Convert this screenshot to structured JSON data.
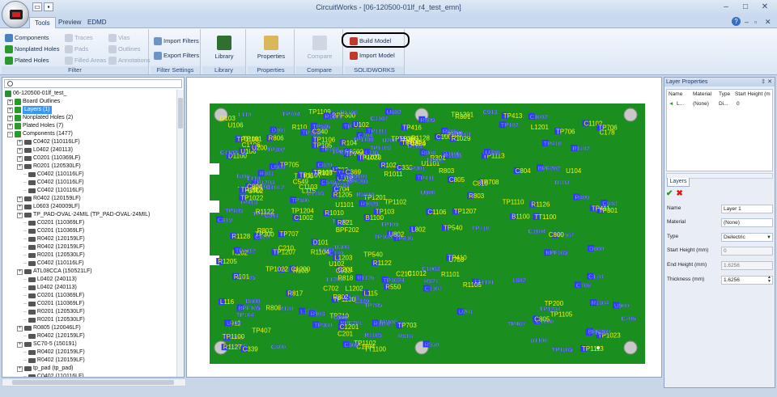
{
  "window": {
    "title": "CircuitWorks - [06-120500-01lf_r4_test_emn]"
  },
  "ribbon_tabs": [
    "Tools",
    "Preview",
    "EDMD"
  ],
  "ribbon": {
    "groups": {
      "filter": "Filter",
      "filter_settings": "Filter Settings",
      "library": "Library",
      "properties": "Properties",
      "compare": "Compare",
      "solidworks": "SOLIDWORKS"
    },
    "filter_items": {
      "components": "Components",
      "nonplated_holes": "Nonplated Holes",
      "plated_holes": "Plated Holes",
      "traces": "Traces",
      "pads": "Pads",
      "filled_areas": "Filled Areas",
      "vias": "Vias",
      "outlines": "Outlines",
      "annotations": "Annotations"
    },
    "import_filters": "Import Filters",
    "export_filters": "Export Filters",
    "library": "Library",
    "properties": "Properties",
    "compare": "Compare",
    "build_model": "Build Model",
    "import_model": "Import Model"
  },
  "tree": {
    "root": "06-120500-01lf_test_",
    "board_outlines": "Board Outlines",
    "layers": "Layers (1)",
    "nonplated_holes": "Nonplated Holes (2)",
    "plated_holes": "Plated Holes (7)",
    "components": "Components (1477)",
    "items": [
      {
        "label": "C0402 (110116LF)",
        "level": 1,
        "expandable": true
      },
      {
        "label": "L0402 (240113)",
        "level": 1,
        "expandable": true
      },
      {
        "label": "C0201 (110369LF)",
        "level": 1,
        "expandable": true
      },
      {
        "label": "R0201 (120530LF)",
        "level": 1,
        "expandable": true
      },
      {
        "label": "C0402 (110116LF)",
        "level": 2,
        "expandable": false
      },
      {
        "label": "C0402 (110116LF)",
        "level": 2,
        "expandable": false
      },
      {
        "label": "C0402 (110116LF)",
        "level": 2,
        "expandable": false
      },
      {
        "label": "R0402 (120159LF)",
        "level": 1,
        "expandable": true
      },
      {
        "label": "L0603 (240009LF)",
        "level": 1,
        "expandable": true
      },
      {
        "label": "TP_PAD-OVAL-24MIL (TP_PAD-OVAL-24MIL)",
        "level": 1,
        "expandable": true
      },
      {
        "label": "C0201 (110369LF)",
        "level": 2,
        "expandable": false
      },
      {
        "label": "C0201 (110369LF)",
        "level": 2,
        "expandable": false
      },
      {
        "label": "R0402 (120159LF)",
        "level": 2,
        "expandable": false
      },
      {
        "label": "R0402 (120159LF)",
        "level": 2,
        "expandable": false
      },
      {
        "label": "R0201 (120530LF)",
        "level": 2,
        "expandable": false
      },
      {
        "label": "C0402 (110116LF)",
        "level": 2,
        "expandable": false
      },
      {
        "label": "ATL08CCA (150521LF)",
        "level": 1,
        "expandable": true
      },
      {
        "label": "L0402 (240113)",
        "level": 2,
        "expandable": false
      },
      {
        "label": "L0402 (240113)",
        "level": 2,
        "expandable": false
      },
      {
        "label": "C0201 (110369LF)",
        "level": 2,
        "expandable": false
      },
      {
        "label": "C0201 (110369LF)",
        "level": 2,
        "expandable": false
      },
      {
        "label": "R0201 (120530LF)",
        "level": 2,
        "expandable": false
      },
      {
        "label": "R0201 (120530LF)",
        "level": 2,
        "expandable": false
      },
      {
        "label": "R0805 (120046LF)",
        "level": 1,
        "expandable": true
      },
      {
        "label": "R0402 (120159LF)",
        "level": 2,
        "expandable": false
      },
      {
        "label": "SC70-5 (150191)",
        "level": 1,
        "expandable": true
      },
      {
        "label": "R0402 (120159LF)",
        "level": 2,
        "expandable": false
      },
      {
        "label": "R0402 (120159LF)",
        "level": 2,
        "expandable": false
      },
      {
        "label": "tp_pad (tp_pad)",
        "level": 1,
        "expandable": true
      },
      {
        "label": "C0402 (110116LF)",
        "level": 2,
        "expandable": false
      }
    ]
  },
  "layer_properties": {
    "title": "Layer Properties",
    "columns": [
      "Name",
      "Material",
      "Type",
      "Start Height (m"
    ],
    "row": {
      "name": "L...",
      "material": "(None)",
      "type": "Di...",
      "start_height": "0"
    },
    "tab": "Layers",
    "fields": {
      "name_label": "Name",
      "name_value": "Layer 1",
      "material_label": "Material",
      "material_value": "(None)",
      "type_label": "Type",
      "type_value": "Dielectric",
      "start_height_label": "Start Height (mm)",
      "start_height_value": "0",
      "end_height_label": "End Height (mm)",
      "end_height_value": "1.6256",
      "thickness_label": "Thickness (mm)",
      "thickness_value": "1.6256"
    }
  },
  "pcb_labels": [
    "TP200",
    "BPF201",
    "C201",
    "TP108",
    "TP109",
    "U201",
    "L116",
    "L115",
    "D101",
    "BPF202",
    "C330",
    "TP105",
    "B1100",
    "TT1100",
    "TT1101",
    "C706",
    "C704",
    "C702",
    "TP1207",
    "C1200",
    "C1201",
    "L1203",
    "L1202",
    "L1201",
    "C918",
    "TP1203",
    "R1205",
    "TP1204",
    "U900",
    "TP1201",
    "D1100",
    "TP1102",
    "U200",
    "R1101",
    "C1104",
    "TP1105",
    "U1100",
    "TP1100",
    "C1102",
    "R1102",
    "C1103",
    "U1101",
    "TP703",
    "TP704",
    "TP706",
    "TP707",
    "TP708",
    "TP705",
    "TP710",
    "U500",
    "TP300",
    "TP301",
    "C170",
    "TP302",
    "TP411",
    "TP410",
    "TP417",
    "TP416",
    "TP413",
    "C805",
    "C804",
    "C800",
    "R821",
    "C820",
    "L802",
    "U802",
    "C911",
    "C913",
    "D800",
    "TP586",
    "TP540",
    "U703",
    "R802",
    "R803",
    "R806",
    "R808",
    "R809",
    "T800",
    "C1003",
    "R818",
    "R817",
    "C819",
    "C1002",
    "TP1024",
    "TP1023",
    "R1126",
    "R1127",
    "R1122",
    "R1128",
    "U104",
    "U102",
    "L110",
    "BPF300",
    "R301",
    "C369",
    "U300",
    "TP407",
    "TP406",
    "R550",
    "C549",
    "R1011",
    "C1012",
    "R1010",
    "D103",
    "C178",
    "R1029",
    "TP1022",
    "U106",
    "R101",
    "R102",
    "R103",
    "R104",
    "R110",
    "C339",
    "C340",
    "TP100",
    "TP101",
    "TP102",
    "TP103",
    "TP104",
    "C210",
    "BPF105",
    "TP1106",
    "TP1107",
    "TP1108",
    "TP1109",
    "TP1110",
    "TP1111",
    "TP1112",
    "TP1113",
    "R1104",
    "R1105",
    "R1106",
    "C1105",
    "C1106",
    "C1107"
  ],
  "colors": {
    "pcb_green": "#1a8f1f",
    "label_yellow": "#f4f400",
    "label_blue": "#2e3df2",
    "selected_blue": "#3399ff",
    "highlight_ring": "#000000"
  }
}
